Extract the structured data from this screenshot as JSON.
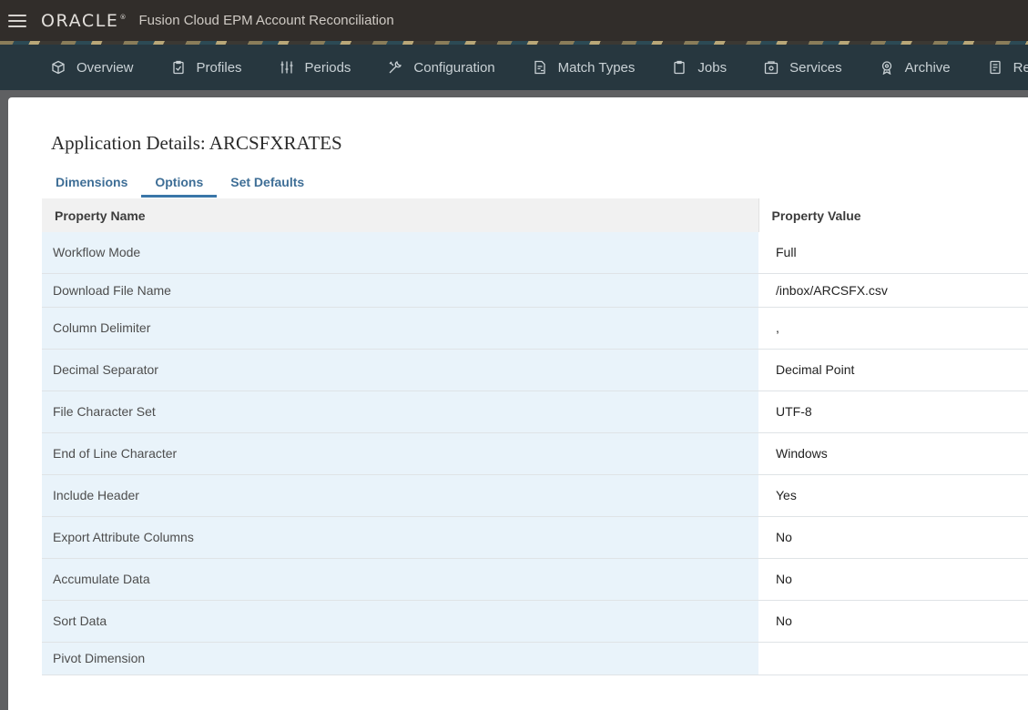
{
  "header": {
    "brand": "ORACLE",
    "app_title": "Fusion Cloud EPM Account Reconciliation"
  },
  "nav": {
    "items": [
      {
        "label": "Overview",
        "icon": "cube-icon"
      },
      {
        "label": "Profiles",
        "icon": "clipboard-check-icon"
      },
      {
        "label": "Periods",
        "icon": "sliders-icon"
      },
      {
        "label": "Configuration",
        "icon": "tools-icon"
      },
      {
        "label": "Match Types",
        "icon": "document-link-icon"
      },
      {
        "label": "Jobs",
        "icon": "clipboard-icon"
      },
      {
        "label": "Services",
        "icon": "gear-box-icon"
      },
      {
        "label": "Archive",
        "icon": "badge-icon"
      },
      {
        "label": "Repo",
        "icon": "report-icon"
      }
    ]
  },
  "page": {
    "title": "Application Details: ARCSFXRATES",
    "tabs": [
      {
        "label": "Dimensions",
        "active": false
      },
      {
        "label": "Options",
        "active": true
      },
      {
        "label": "Set Defaults",
        "active": false
      }
    ],
    "table": {
      "columns": [
        "Property Name",
        "Property Value"
      ],
      "rows": [
        {
          "name": "Workflow Mode",
          "value": "Full"
        },
        {
          "name": "Download File Name",
          "value": "/inbox/ARCSFX.csv"
        },
        {
          "name": "Column Delimiter",
          "value": ","
        },
        {
          "name": "Decimal Separator",
          "value": "Decimal Point"
        },
        {
          "name": "File Character Set",
          "value": "UTF-8"
        },
        {
          "name": "End of Line Character",
          "value": "Windows"
        },
        {
          "name": "Include Header",
          "value": "Yes"
        },
        {
          "name": "Export Attribute Columns",
          "value": "No"
        },
        {
          "name": "Accumulate Data",
          "value": "No"
        },
        {
          "name": "Sort Data",
          "value": "No"
        },
        {
          "name": "Pivot Dimension",
          "value": ""
        }
      ]
    }
  }
}
